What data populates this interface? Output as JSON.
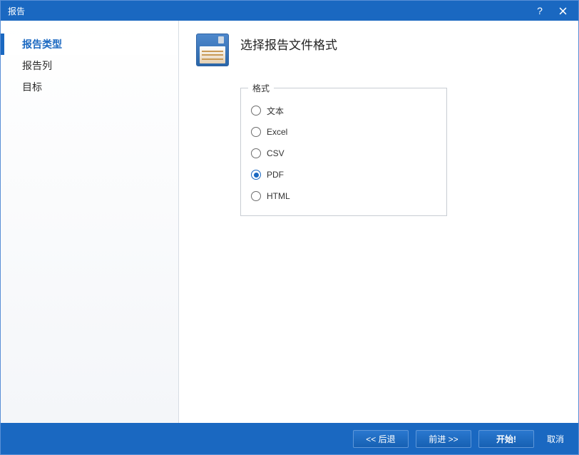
{
  "window": {
    "title": "报告"
  },
  "sidebar": {
    "items": [
      {
        "label": "报告类型",
        "selected": true
      },
      {
        "label": "报告列",
        "selected": false
      },
      {
        "label": "目标",
        "selected": false
      }
    ]
  },
  "main": {
    "page_title": "选择报告文件格式",
    "format_group_label": "格式",
    "formats": [
      {
        "label": "文本",
        "selected": false
      },
      {
        "label": "Excel",
        "selected": false
      },
      {
        "label": "CSV",
        "selected": false
      },
      {
        "label": "PDF",
        "selected": true
      },
      {
        "label": "HTML",
        "selected": false
      }
    ]
  },
  "footer": {
    "back": "<<  后退",
    "next": "前进  >>",
    "start": "开始!",
    "cancel": "取消"
  }
}
